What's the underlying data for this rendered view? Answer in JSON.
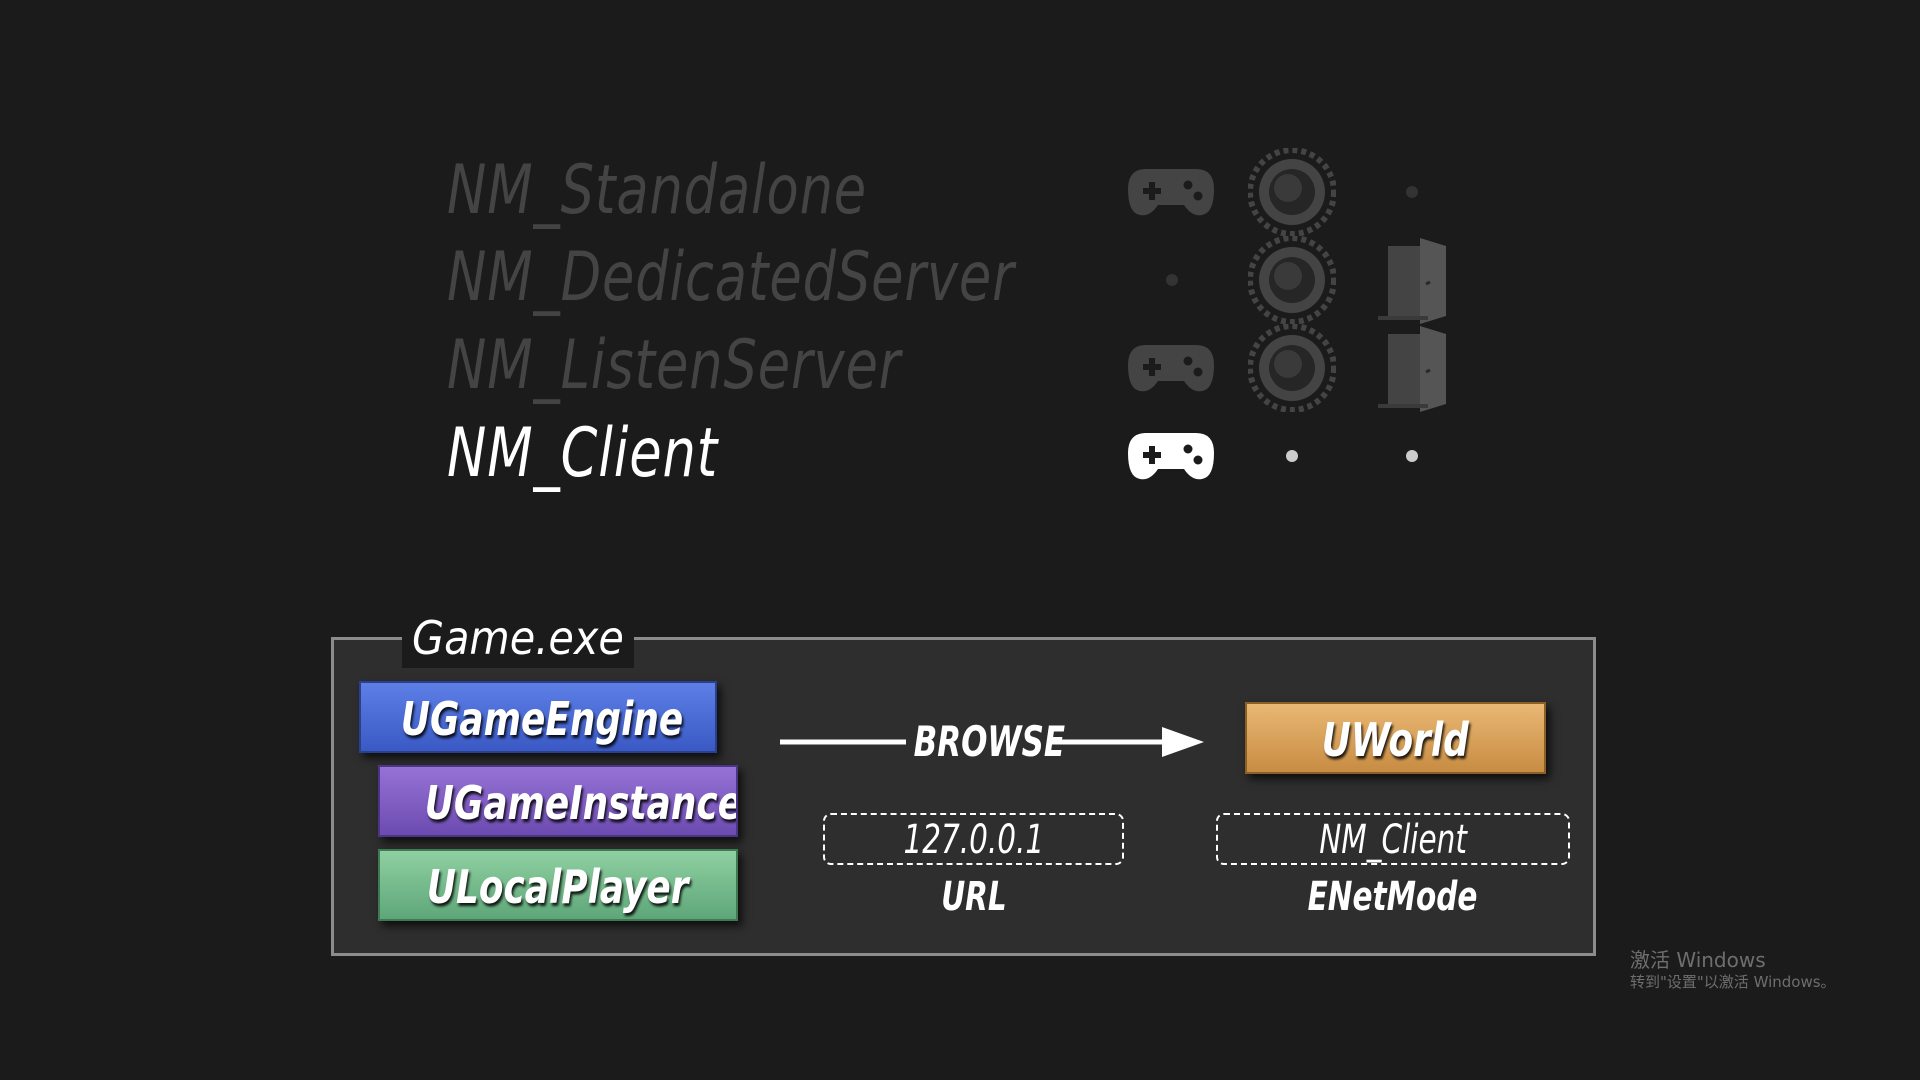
{
  "net_modes": [
    {
      "label": "NM_Standalone",
      "active": false,
      "player": true,
      "server": true,
      "network": false
    },
    {
      "label": "NM_DedicatedServer",
      "active": false,
      "player": false,
      "server": true,
      "network": true
    },
    {
      "label": "NM_ListenServer",
      "active": false,
      "player": true,
      "server": true,
      "network": true
    },
    {
      "label": "NM_Client",
      "active": true,
      "player": true,
      "server": false,
      "network": false
    }
  ],
  "icons": {
    "player": "gamepad-icon",
    "server": "server-gear-icon",
    "network": "network-door-icon",
    "absent": "dot-icon"
  },
  "colors": {
    "dim": "#444444",
    "active": "#ffffff",
    "background": "#1b1b1b"
  },
  "game_exe": {
    "title": "Game.exe",
    "classes": {
      "engine": "UGameEngine",
      "instance": "UGameInstance",
      "local_player": "ULocalPlayer"
    },
    "browse_label": "BROWSE",
    "world": "UWorld",
    "url_value": "127.0.0.1",
    "url_caption": "URL",
    "netmode_value": "NM_Client",
    "netmode_caption": "ENetMode"
  },
  "watermark": {
    "line1": "激活 Windows",
    "line2": "转到\"设置\"以激活 Windows。"
  }
}
